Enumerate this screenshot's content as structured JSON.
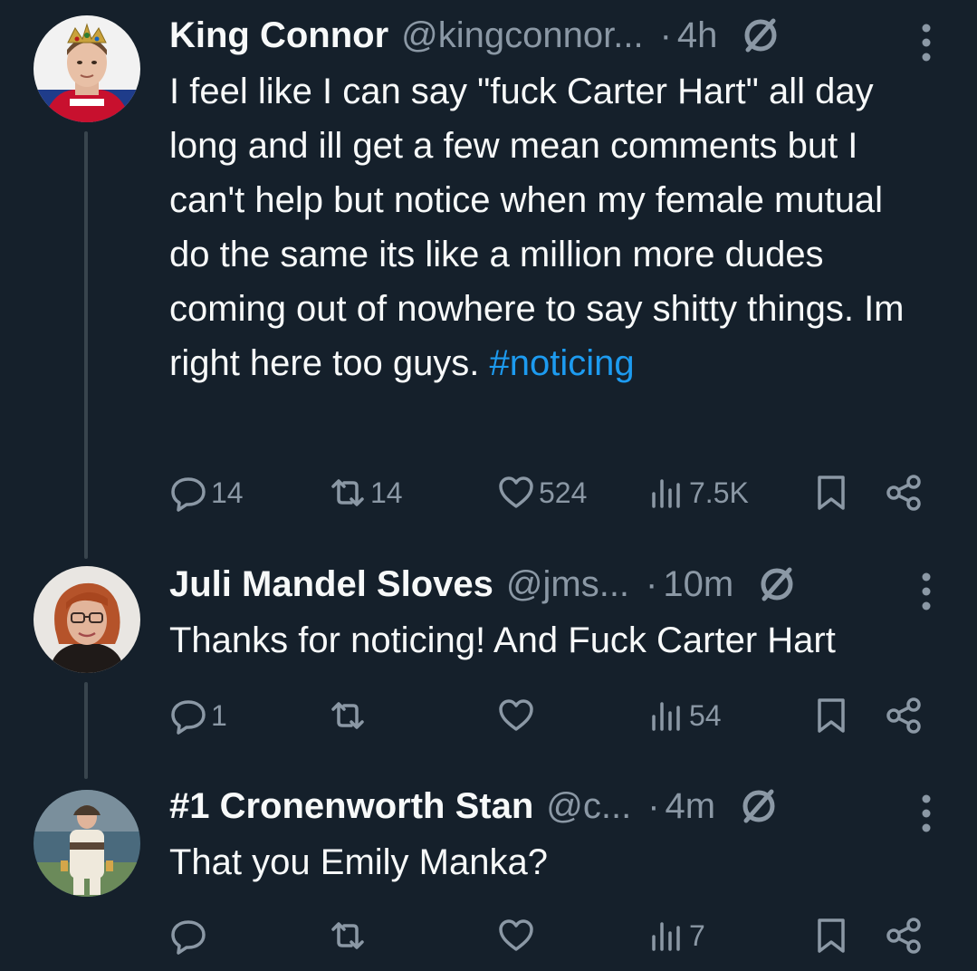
{
  "tweets": [
    {
      "name": "King Connor",
      "handle": "@kingconnor...",
      "dot": "·",
      "time": "4h",
      "text_plain": "I feel like I can say \"fuck Carter Hart\" all day long and ill get a few mean comments but I can't help but notice when my female mutual do the same its like a million more dudes coming out of nowhere to say shitty things. Im right here too guys.",
      "hashtag": "#noticing",
      "replies": "14",
      "retweets": "14",
      "likes": "524",
      "views": "7.5K"
    },
    {
      "name": "Juli Mandel Sloves",
      "handle": "@jms...",
      "dot": "·",
      "time": "10m",
      "text_plain": "Thanks for noticing! And Fuck Carter Hart",
      "replies": "1",
      "retweets": "",
      "likes": "",
      "views": "54"
    },
    {
      "name": "#1 Cronenworth Stan",
      "handle": "@c...",
      "dot": "·",
      "time": "4m",
      "text_plain": "That you Emily Manka?",
      "replies": "",
      "retweets": "",
      "likes": "",
      "views": "7"
    }
  ],
  "icons": {
    "reply": "reply-icon",
    "retweet": "retweet-icon",
    "like": "heart-icon",
    "views": "views-icon",
    "bookmark": "bookmark-icon",
    "share": "share-icon",
    "verified": "circle-slash-icon",
    "more": "more-vertical-icon"
  },
  "colors": {
    "background": "#15202b",
    "text": "#f7f9f9",
    "muted": "#8b98a5",
    "link": "#1d9bf0",
    "thread_line": "#38444d"
  }
}
